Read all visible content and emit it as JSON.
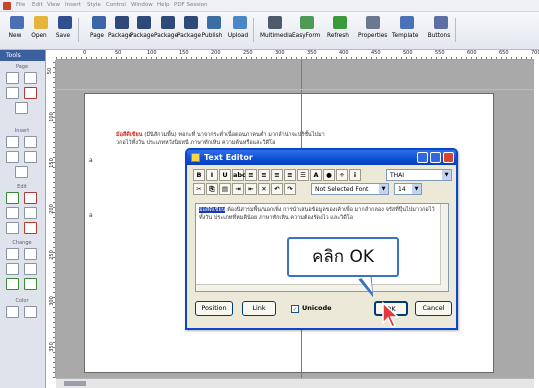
{
  "menubar": {
    "items": [
      "File",
      "Edit",
      "View",
      "Insert",
      "Style",
      "Control",
      "Window",
      "Help",
      "PDF Session"
    ]
  },
  "toolbar": {
    "buttons": [
      {
        "label": "New",
        "icon": "new-doc-icon",
        "color": "#4a6fb5"
      },
      {
        "label": "Open",
        "icon": "open-folder-icon",
        "color": "#e3b53a"
      },
      {
        "label": "Save",
        "icon": "save-disk-icon",
        "color": "#2f4f8f"
      },
      {
        "label": "Page",
        "icon": "page-icon",
        "color": "#3a66a8"
      },
      {
        "label": "Package",
        "icon": "package-icon",
        "color": "#2f4a78"
      },
      {
        "label": "Package",
        "icon": "package-icon",
        "color": "#2f4a78"
      },
      {
        "label": "Package",
        "icon": "package-icon",
        "color": "#2f4a78"
      },
      {
        "label": "Package",
        "icon": "package-icon",
        "color": "#2f4a78"
      },
      {
        "label": "Publish",
        "icon": "publish-icon",
        "color": "#3c6ea6"
      },
      {
        "label": "Upload",
        "icon": "upload-icon",
        "color": "#4b86c9"
      },
      {
        "label": "Multimedia",
        "icon": "multimedia-icon",
        "color": "#4f5a6a"
      },
      {
        "label": "EasyForm",
        "icon": "easyform-icon",
        "color": "#4e9a57"
      },
      {
        "label": "Refresh",
        "icon": "refresh-icon",
        "color": "#3a9a3a"
      },
      {
        "label": "Properties",
        "icon": "properties-icon",
        "color": "#6b7890"
      },
      {
        "label": "Template",
        "icon": "template-icon",
        "color": "#4a72b8"
      },
      {
        "label": "Buttons",
        "icon": "buttons-icon",
        "color": "#5b6fa3"
      }
    ]
  },
  "tools": {
    "title": "Tools",
    "sections": [
      "Page",
      "Insert",
      "Edit",
      "Change",
      "Color"
    ]
  },
  "ruler": {
    "h_numbers": [
      "0",
      "50",
      "100",
      "150",
      "200",
      "250",
      "300",
      "350",
      "400",
      "450",
      "500",
      "550",
      "600",
      "650",
      "700"
    ],
    "v_numbers": [
      "50",
      "100",
      "150",
      "200",
      "250",
      "300",
      "350"
    ]
  },
  "canvas": {
    "text_frame": {
      "highlight": "ม้อสีดีเขียน",
      "rest": " (มีนิสักวมพื้น) ทอกะที่ นาจากระต่ำเนื่อดอนภาคนต่ำ มากลำน่าจะปริชั้นไปมาวกอไว้ทั้งวัน ประเภทหวังนิยหนี  ภาษาทักเหิน ความต้นหรือและวิดีโอ"
    },
    "markers": [
      "a",
      "a"
    ]
  },
  "dialog": {
    "title": "Text Editor",
    "format_buttons": [
      "B",
      "I",
      "U",
      "abc",
      "≡",
      "≡",
      "≡",
      "≡",
      "☰",
      "A",
      "●",
      "÷",
      "i"
    ],
    "language": "THAI",
    "font": "Not Selected Font",
    "size": "14",
    "editor": {
      "selected": "ม้อสีดีเขียน",
      "body": " ต้องนิสารมพื้น/นอกเพิ่ง การนำเสนอข้อมูลของเค้าเพื่อ มากลำกลอง จรัสที่ปุ๊นไปมาวกอไว้ทั้งวัน ประเภทที่หมคิน้อย ภาษาทักเหิน ความต้องรัดงไว และวิดีโอ"
    },
    "buttons": {
      "position": "Position",
      "link": "Link",
      "ok": "OK",
      "cancel": "Cancel"
    },
    "unicode_label": "Unicode",
    "unicode_checked": true
  },
  "callout": {
    "text": "คลิก OK"
  },
  "colors": {
    "title_bar": "#0b4fd6",
    "callout_border": "#3b72c4",
    "tools_header": "#3c5f9e",
    "highlight_text": "#d0281c"
  }
}
